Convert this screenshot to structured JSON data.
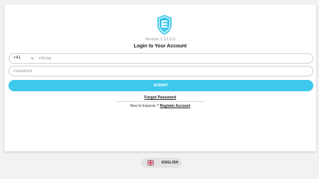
{
  "login": {
    "version": "Version 1.12.0.0",
    "title": "Login to Your Account",
    "country_code": "+41",
    "phone_placeholder": "Phone",
    "password_placeholder": "Password",
    "submit_label": "SUBMIT",
    "forgot_label": "Forgot Password",
    "register_prompt": "New to Equesio ?",
    "register_label": "Register Account"
  },
  "language": {
    "label": "ENGLISH",
    "flag_icon": "uk-flag-icon"
  },
  "colors": {
    "accent": "#3ec8ec",
    "logo": "#3ec8ec",
    "background": "#f2f2f2",
    "card": "#ffffff"
  },
  "icons": [
    "shield-logo-icon",
    "chevron-down-icon",
    "uk-flag-icon"
  ]
}
